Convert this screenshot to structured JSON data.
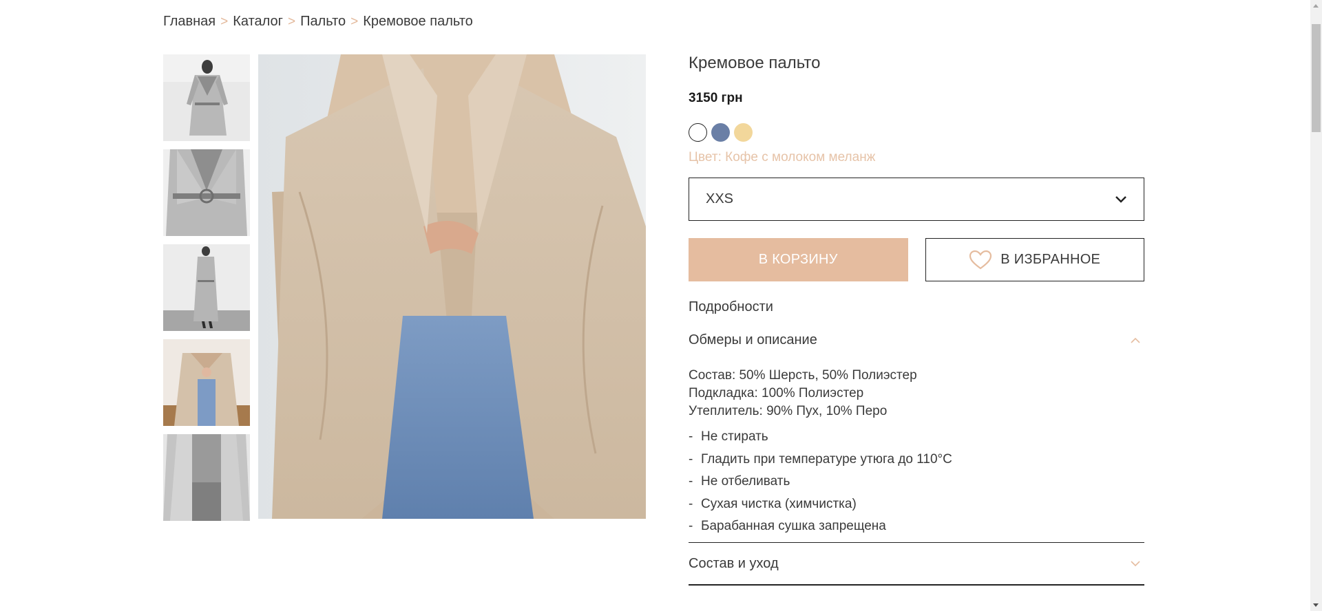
{
  "breadcrumb": {
    "items": [
      "Главная",
      "Каталог",
      "Пальто",
      "Кремовое пальто"
    ],
    "separator": ">"
  },
  "product": {
    "title": "Кремовое пальто",
    "price": "3150 грн",
    "colors": [
      {
        "name": "white",
        "hex": "#ffffff",
        "selected": true
      },
      {
        "name": "blue",
        "hex": "#6a7fa6",
        "selected": false
      },
      {
        "name": "yellow",
        "hex": "#f2d79b",
        "selected": false
      }
    ],
    "color_label": "Цвет: Кофе с молоком меланж",
    "size_selected": "XXS"
  },
  "actions": {
    "cart_label": "В КОРЗИНУ",
    "favorite_label": "В ИЗБРАННОЕ"
  },
  "details": {
    "heading": "Подробности",
    "accordion1": {
      "title": "Обмеры и описание",
      "expanded": true,
      "composition": [
        "Состав: 50% Шерсть, 50% Полиэстер",
        "Подкладка: 100% Полиэстер",
        "Утеплитель: 90% Пух, 10% Перо"
      ],
      "care": [
        "Не стирать",
        "Гладить при температуре утюга до 110°С",
        "Не отбеливать",
        "Сухая чистка (химчистка)",
        "Барабанная сушка запрещена"
      ]
    },
    "accordion2": {
      "title": "Состав и уход",
      "expanded": false
    }
  },
  "colors": {
    "accent": "#e5bc9f",
    "accent_text": "#e6c3a8",
    "border": "#222222",
    "text": "#3a3a3a"
  },
  "icons": {
    "size_dropdown": "chevron-down-icon",
    "favorite": "heart-icon",
    "accordion_open": "chevron-up-icon",
    "accordion_closed": "chevron-down-icon"
  }
}
